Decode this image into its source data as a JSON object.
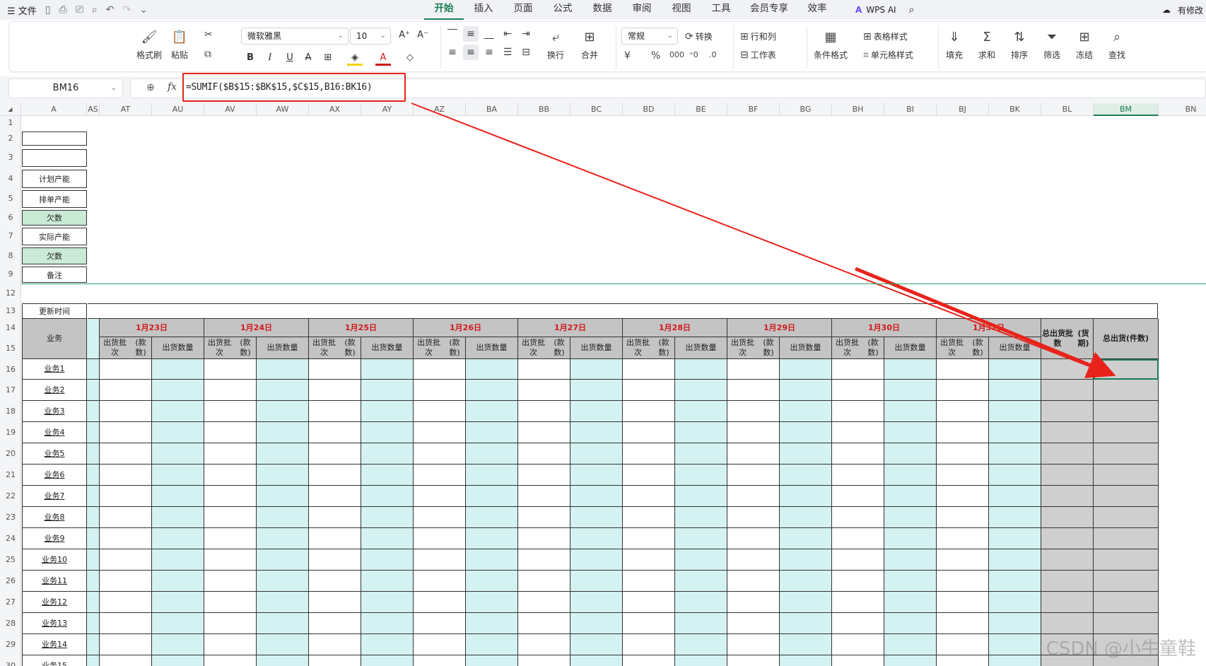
{
  "menubar": {
    "menu_label": "文件",
    "tabs": [
      "开始",
      "插入",
      "页面",
      "公式",
      "数据",
      "审阅",
      "视图",
      "工具",
      "会员专享",
      "效率"
    ],
    "active_tab": "开始",
    "ai_label": "WPS AI",
    "status": "有修改"
  },
  "ribbon": {
    "format_painter": "格式刷",
    "paste": "粘贴",
    "font_name": "微软雅黑",
    "font_size": "10",
    "wrap": "换行",
    "merge": "合并",
    "number_format": "常规",
    "convert": "转换",
    "row_col": "行和列",
    "worksheet": "工作表",
    "cond_format": "条件格式",
    "table_style": "表格样式",
    "cell_style": "单元格样式",
    "fill": "填充",
    "sum": "求和",
    "sort": "排序",
    "filter": "筛选",
    "freeze": "冻结",
    "find": "查找"
  },
  "formula_bar": {
    "cell_ref": "BM16",
    "formula": "=SUMIF($B$15:$BK$15,$C$15,B16:BK16)"
  },
  "columns": [
    "A",
    "AS",
    "AT",
    "AU",
    "AV",
    "AW",
    "AX",
    "AY",
    "AZ",
    "BA",
    "BB",
    "BC",
    "BD",
    "BE",
    "BF",
    "BG",
    "BH",
    "BI",
    "BJ",
    "BK",
    "BL",
    "BM",
    "BN"
  ],
  "selected_column": "BM",
  "rows": [
    "1",
    "2",
    "3",
    "4",
    "5",
    "6",
    "7",
    "8",
    "9",
    "12",
    "13",
    "14",
    "15",
    "16",
    "17",
    "18",
    "19",
    "20",
    "21",
    "22",
    "23",
    "24",
    "25",
    "26",
    "27",
    "28",
    "29",
    "30"
  ],
  "labels_top": [
    "计划产能",
    "排单产能",
    "欠数",
    "实际产能",
    "欠数",
    "备注"
  ],
  "update_time": "更新时间",
  "biz_header": "业务",
  "dates": [
    "1月23日",
    "1月24日",
    "1月25日",
    "1月26日",
    "1月27日",
    "1月28日",
    "1月29日",
    "1月30日",
    "1月31日"
  ],
  "subheaders": {
    "batch_line1": "出货批次",
    "batch_line2": "(款数)",
    "qty_line1": "出货",
    "qty_line2": "数量"
  },
  "total_batch": [
    "总出货批数",
    "(货期)"
  ],
  "total_qty": [
    "总出货",
    "(件数)"
  ],
  "businesses": [
    "业务1",
    "业务2",
    "业务3",
    "业务4",
    "业务5",
    "业务6",
    "业务7",
    "业务8",
    "业务9",
    "业务10",
    "业务11",
    "业务12",
    "业务13",
    "业务14",
    "业务15"
  ],
  "watermark": "CSDN @小牛童鞋",
  "colors": {
    "accent": "#1a7d55",
    "highlight_red": "#e8231b",
    "green_fill": "#c9ead5",
    "cyan_fill": "#d4f2f1",
    "gray_fill": "#cfcfcf"
  }
}
